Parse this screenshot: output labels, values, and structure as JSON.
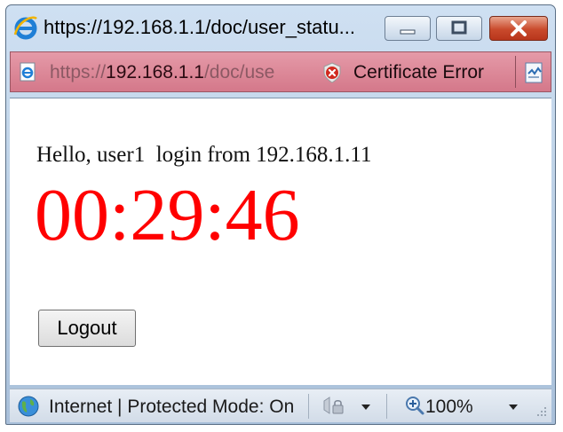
{
  "window": {
    "title": "https://192.168.1.1/doc/user_statu..."
  },
  "address_bar": {
    "url_scheme": "https://",
    "url_host": "192.168.1.1",
    "url_path": "/doc/use",
    "certificate_label": "Certificate Error"
  },
  "content": {
    "greeting": "Hello, user1  login from 192.168.1.11",
    "timer": "00:29:46",
    "logout_label": "Logout"
  },
  "status_bar": {
    "zone_text": "Internet | Protected Mode: On",
    "zoom_level": "100%"
  },
  "icons": {
    "browser": "ie-logo-icon",
    "page": "page-icon",
    "certificate": "certificate-error-icon",
    "compatibility": "compatibility-view-icon",
    "zone": "globe-icon",
    "protected": "lock-icon",
    "zoom": "zoom-icon"
  },
  "colors": {
    "timer": "#ff0000",
    "address_bar_error": "#e59aa8",
    "close_button": "#c94a2c"
  }
}
